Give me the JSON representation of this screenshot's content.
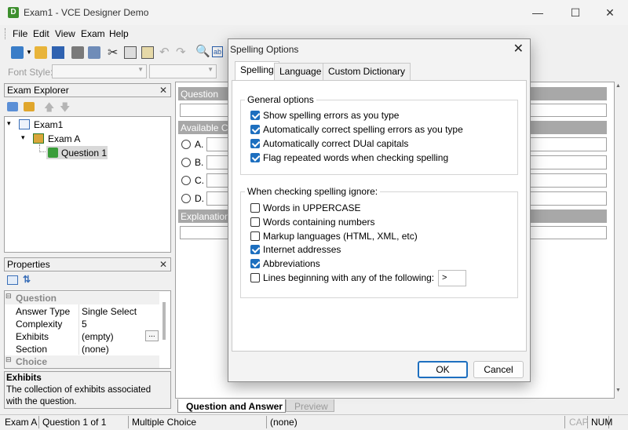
{
  "window": {
    "title": "Exam1 - VCE Designer Demo",
    "app_icon": "D"
  },
  "menu": [
    "File",
    "Edit",
    "View",
    "Exam",
    "Help"
  ],
  "fontbar": {
    "font_style_label": "Font Style:"
  },
  "explorer": {
    "title": "Exam Explorer",
    "tree": [
      {
        "label": "Exam1"
      },
      {
        "label": "Exam A"
      },
      {
        "label": "Question 1"
      }
    ]
  },
  "properties": {
    "title": "Properties",
    "sections": [
      "Question",
      "Choice"
    ],
    "rows": [
      {
        "name": "Answer Type",
        "value": "Single Select"
      },
      {
        "name": "Complexity",
        "value": "5"
      },
      {
        "name": "Exhibits",
        "value": "(empty)",
        "button": "..."
      },
      {
        "name": "Section",
        "value": "(none)"
      }
    ],
    "desc_title": "Exhibits",
    "desc_text": "The collection of exhibits associated with the question."
  },
  "editor": {
    "question_label": "Question",
    "choices_label": "Available Ch",
    "choices": [
      "A.",
      "B.",
      "C.",
      "D."
    ],
    "explanation_label": "Explanation",
    "tabs": [
      "Question and Answer",
      "Preview"
    ]
  },
  "status": [
    "Exam A",
    "Question 1 of 1",
    "Multiple Choice",
    "(none)",
    "CAP",
    "NUM"
  ],
  "dialog": {
    "title": "Spelling Options",
    "tabs": [
      "Spelling",
      "Language",
      "Custom Dictionary"
    ],
    "general": {
      "title": "General options",
      "items": [
        {
          "label": "Show spelling errors as you type",
          "checked": true
        },
        {
          "label": "Automatically correct spelling errors as you type",
          "checked": true
        },
        {
          "label": "Automatically correct DUal capitals",
          "checked": true
        },
        {
          "label": "Flag repeated words when checking spelling",
          "checked": true
        }
      ]
    },
    "ignore": {
      "title": "When checking spelling ignore:",
      "items": [
        {
          "label": "Words in UPPERCASE",
          "checked": false
        },
        {
          "label": "Words containing numbers",
          "checked": false
        },
        {
          "label": "Markup languages (HTML, XML, etc)",
          "checked": false
        },
        {
          "label": "Internet addresses",
          "checked": true
        },
        {
          "label": "Abbreviations",
          "checked": true
        },
        {
          "label": "Lines beginning with any of the following:",
          "checked": false
        }
      ],
      "prefix_value": ">"
    },
    "ok": "OK",
    "cancel": "Cancel"
  },
  "colors": {
    "accent": "#1d6fbf",
    "band_gray": "#a8a8a8"
  }
}
